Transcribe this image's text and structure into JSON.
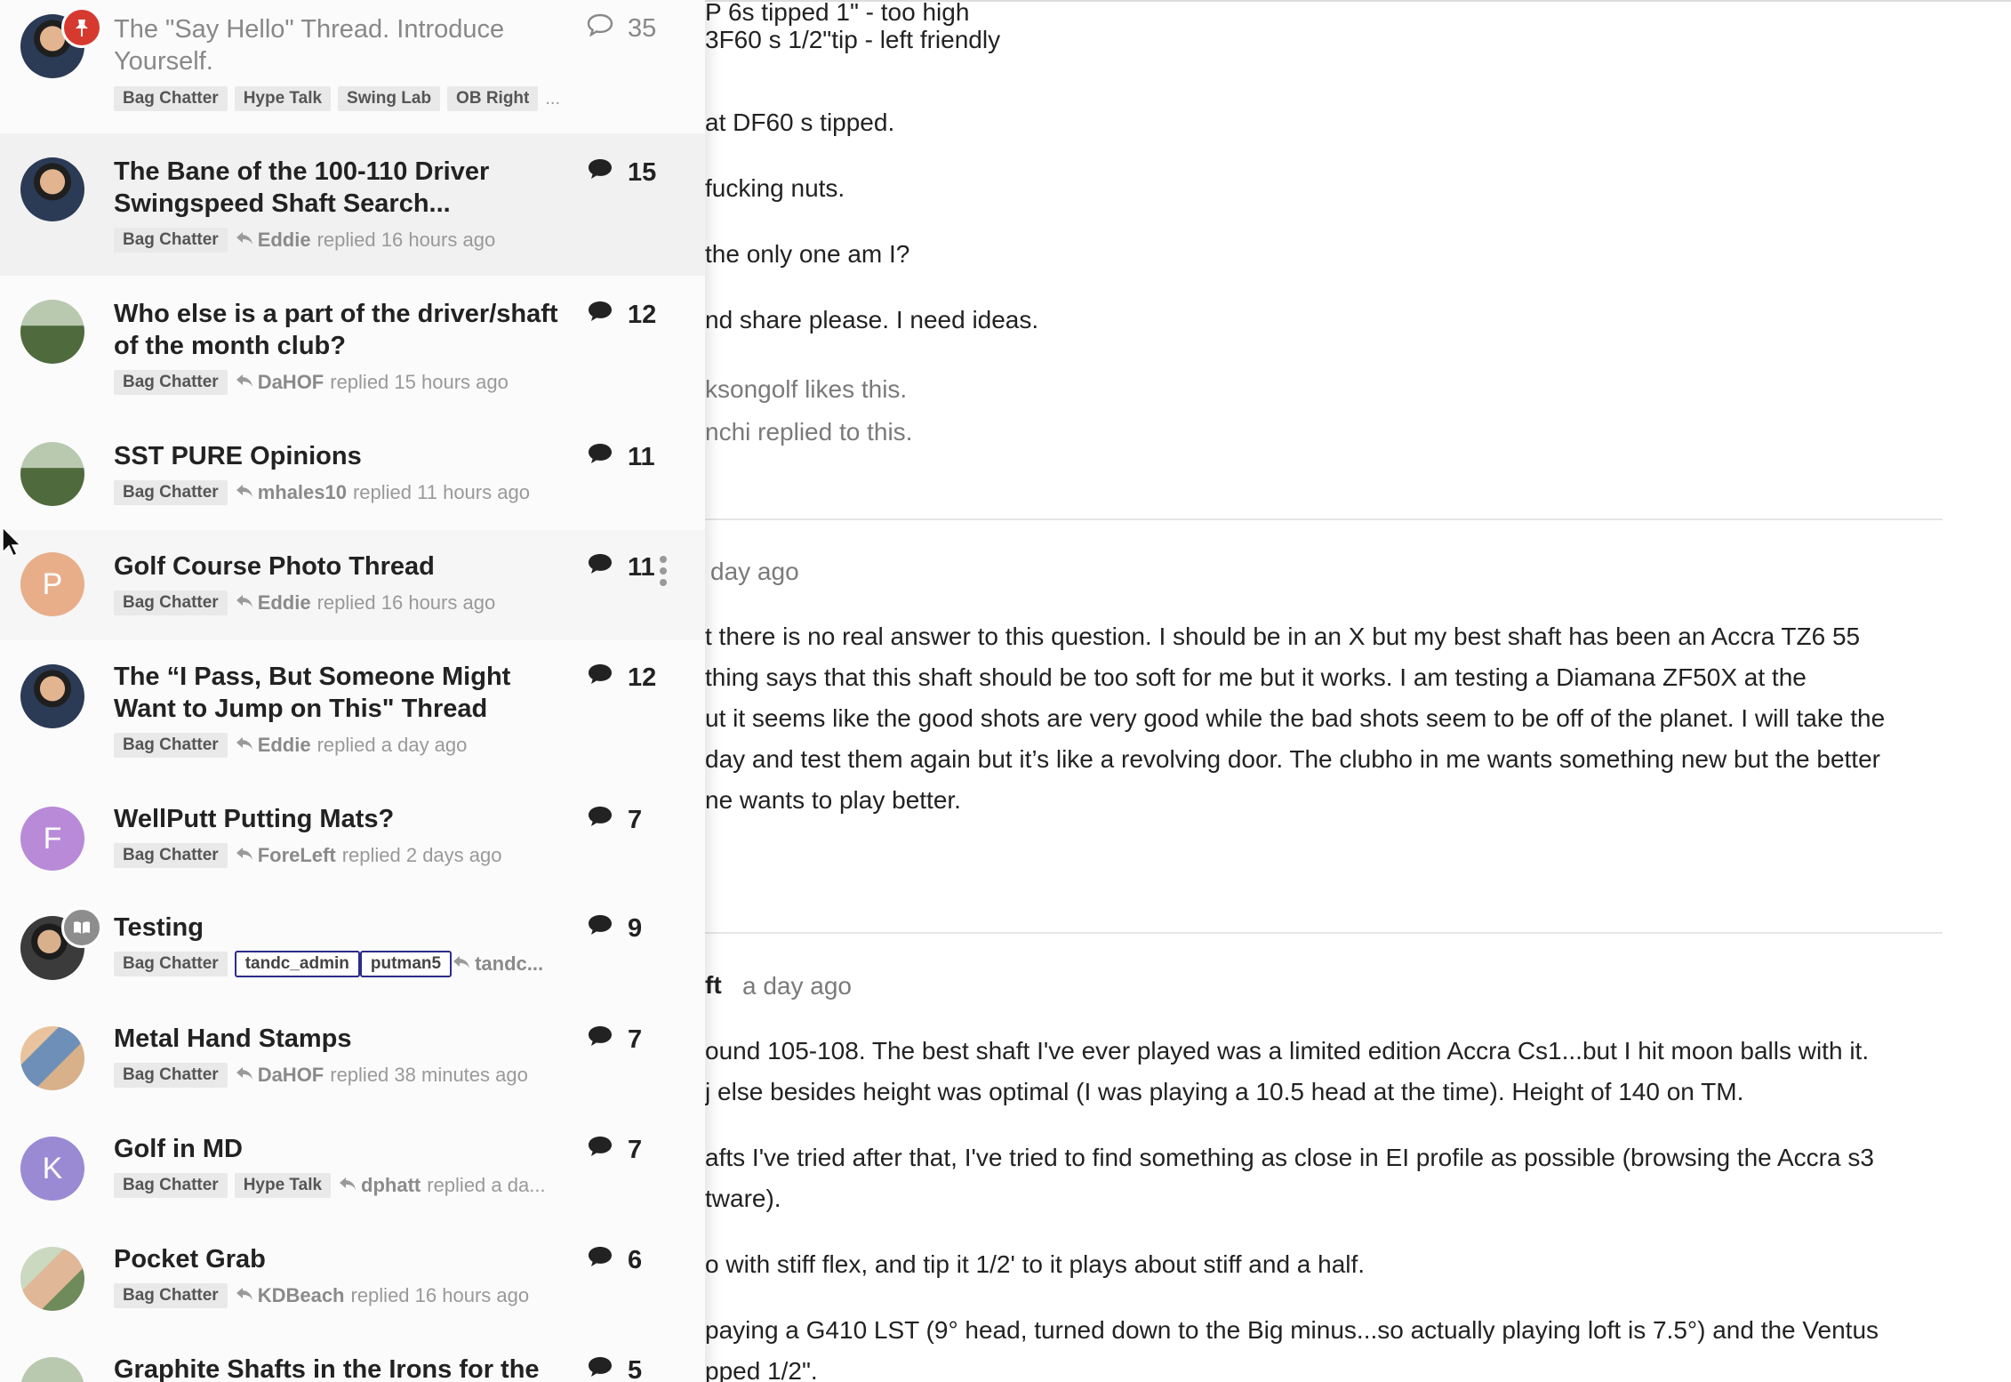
{
  "topics": [
    {
      "title": "The \"Say Hello\" Thread. Introduce Yourself.",
      "count": "35",
      "tags": [
        "Bag Chatter",
        "Hype Talk",
        "Swing Lab",
        "OB Right"
      ],
      "more": "..."
    },
    {
      "title": "The Bane of the 100-110 Driver Swingspeed Shaft Search...",
      "count": "15",
      "tags": [
        "Bag Chatter"
      ],
      "user": "Eddie",
      "reply_text": "replied 16 hours ago"
    },
    {
      "title": "Who else is a part of the driver/shaft of the month club?",
      "count": "12",
      "tags": [
        "Bag Chatter"
      ],
      "user": "DaHOF",
      "reply_text": "replied 15 hours ago"
    },
    {
      "title": "SST PURE Opinions",
      "count": "11",
      "tags": [
        "Bag Chatter"
      ],
      "user": "mhales10",
      "reply_text": "replied 11 hours ago"
    },
    {
      "title": "Golf Course Photo Thread",
      "count": "11",
      "avatar_letter": "P",
      "tags": [
        "Bag Chatter"
      ],
      "user": "Eddie",
      "reply_text": "replied 16 hours ago"
    },
    {
      "title": "The “I Pass, But Someone Might Want to Jump on This\" Thread",
      "count": "12",
      "tags": [
        "Bag Chatter"
      ],
      "user": "Eddie",
      "reply_text": "replied a day ago"
    },
    {
      "title": "WellPutt Putting Mats?",
      "count": "7",
      "avatar_letter": "F",
      "tags": [
        "Bag Chatter"
      ],
      "user": "ForeLeft",
      "reply_text": "replied 2 days ago"
    },
    {
      "title": "Testing",
      "count": "9",
      "tags": [
        "Bag Chatter"
      ],
      "user_tags": [
        "tandc_admin",
        "putman5"
      ],
      "user": "tandc..."
    },
    {
      "title": "Metal Hand Stamps",
      "count": "7",
      "tags": [
        "Bag Chatter"
      ],
      "user": "DaHOF",
      "reply_text": "replied 38 minutes ago"
    },
    {
      "title": "Golf in MD",
      "count": "7",
      "avatar_letter": "K",
      "tags": [
        "Bag Chatter",
        "Hype Talk"
      ],
      "user": "dphatt",
      "reply_text": "replied a da..."
    },
    {
      "title": "Pocket Grab",
      "count": "6",
      "tags": [
        "Bag Chatter"
      ],
      "user": "KDBeach",
      "reply_text": "replied 16 hours ago"
    },
    {
      "title": "Graphite Shafts in the Irons for the",
      "count": "5"
    }
  ],
  "post": {
    "lines": [
      "P 6s tipped 1\" - too high",
      "3F60 s 1/2\"tip - left friendly",
      "at DF60 s tipped.",
      "fucking nuts.",
      "the only one am I?",
      "nd share please. I need ideas.",
      "ksongolf likes this.",
      "nchi replied to this.",
      "day ago",
      "t there is no real answer to this question. I should be in an X but my best shaft has been an Accra TZ6 55",
      "thing says that this shaft should be too soft for me but it works. I am testing a Diamana ZF50X at the",
      "ut it seems like the good shots are very good while the bad shots seem to be off of the planet. I will take the",
      "day and test them again but it’s like a revolving door. The clubho in me wants something new but the better",
      "ne wants to play better.",
      "ft",
      "a day ago",
      "ound 105-108. The best shaft I've ever played was a limited edition Accra Cs1...but I hit moon balls with it.",
      "j else besides height was optimal (I was playing a 10.5 head at the time). Height of 140 on TM.",
      "afts I've tried after that, I've tried to find something as close in EI profile as possible (browsing the Accra s3",
      "tware).",
      "o with stiff flex, and tip it 1/2' to it plays about stiff and a half.",
      "paying a G410 LST (9° head, turned down to the Big minus...so actually playing loft is 7.5°) and the Ventus",
      "pped 1/2\"."
    ]
  },
  "colors": {
    "pin_badge": "#d63a2f",
    "avatar_p": "#e8ae8a",
    "avatar_f": "#b88ad8",
    "avatar_k": "#9a8ad4",
    "user_tag_border": "#2c2c8a"
  },
  "icons": {
    "pin": "pin-icon",
    "comment": "comment-bubble-icon",
    "reply": "reply-arrow-icon",
    "more": "vertical-ellipsis-icon",
    "book": "book-icon"
  }
}
